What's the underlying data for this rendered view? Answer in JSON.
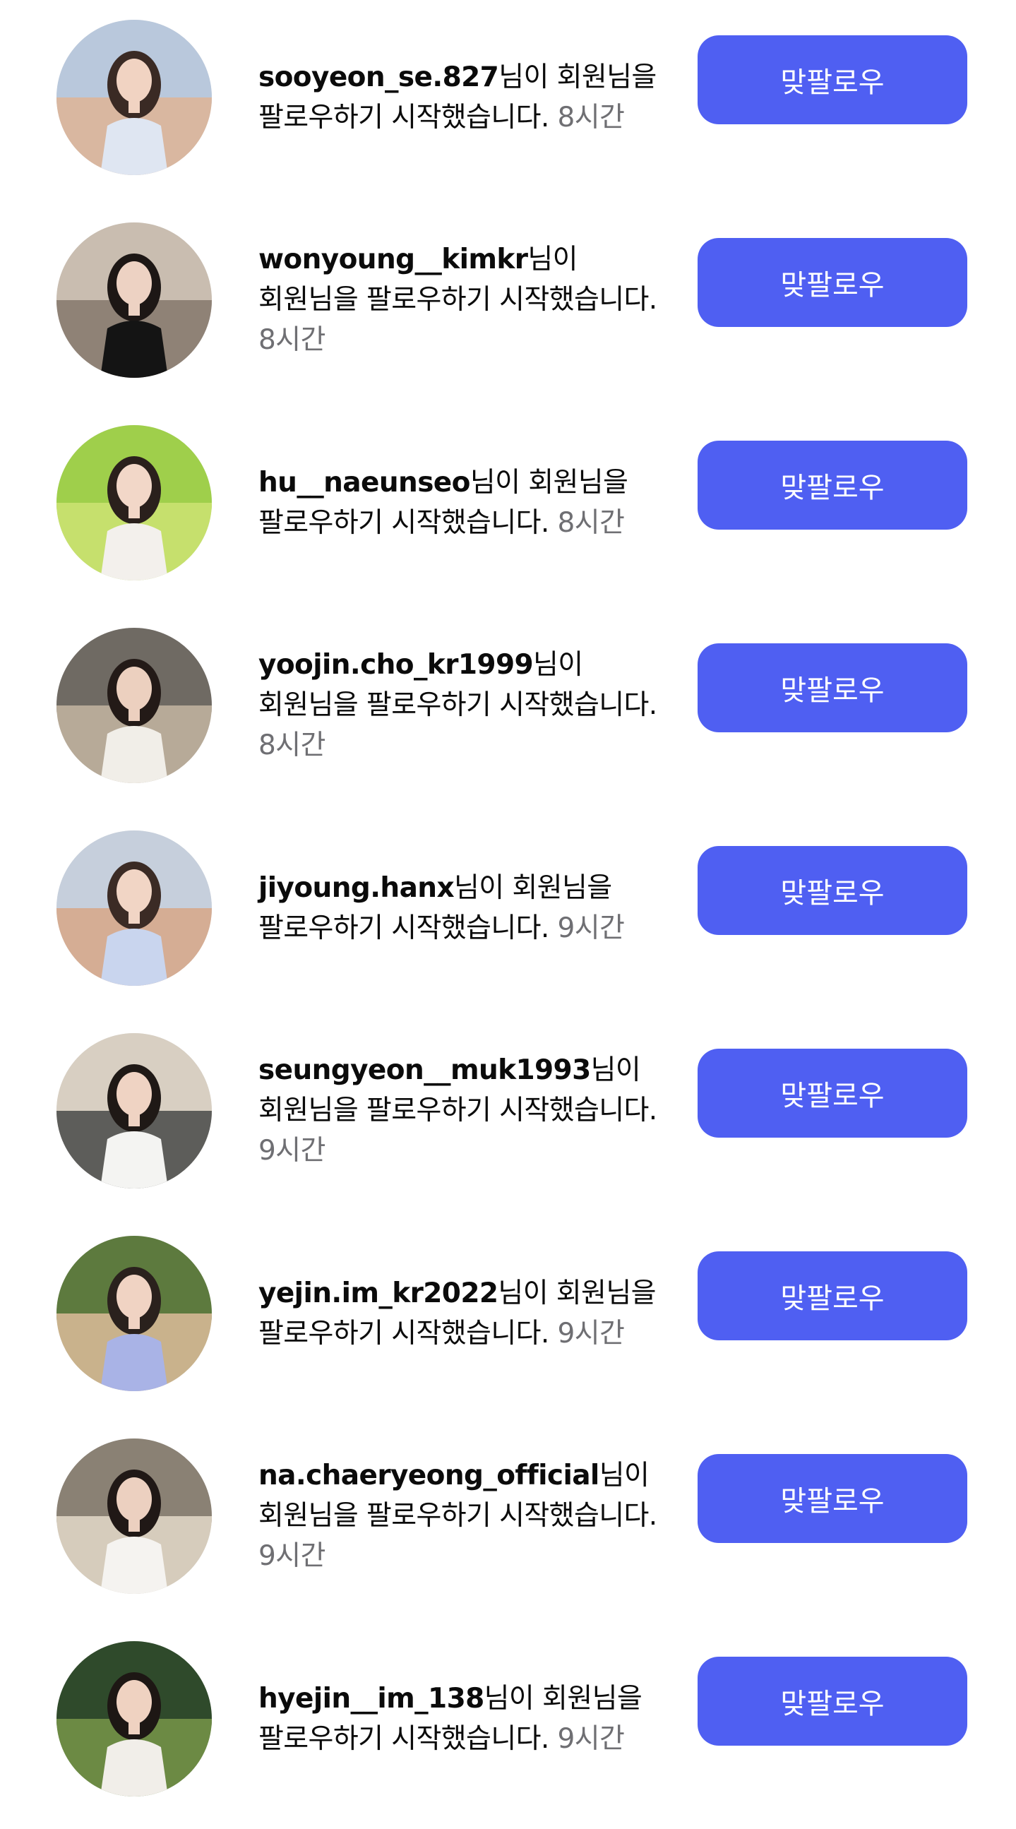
{
  "theme": {
    "button_color": "#4f5ff2",
    "button_text_color": "#ffffff",
    "time_color": "#6f6f73"
  },
  "notifications": [
    {
      "username": "sooyeon_se.827",
      "message": "님이 회원님을 팔로우하기 시작했습니다.",
      "time": "8시간",
      "button_label": "맞팔로우",
      "avatar": {
        "sky": "#b9c8dc",
        "ground": "#d9b7a0",
        "outfit": "#dfe6f2",
        "hair": "#3a2a24",
        "skin": "#f1d3c2"
      }
    },
    {
      "username": "wonyoung__kimkr",
      "message": "님이 회원님을 팔로우하기 시작했습니다.",
      "time": "8시간",
      "button_label": "맞팔로우",
      "avatar": {
        "sky": "#c9bdb0",
        "ground": "#8f8276",
        "outfit": "#141414",
        "hair": "#1d1715",
        "skin": "#edd2c3"
      }
    },
    {
      "username": "hu__naeunseo",
      "message": "님이 회원님을 팔로우하기 시작했습니다.",
      "time": "8시간",
      "button_label": "맞팔로우",
      "avatar": {
        "sky": "#9fcf4b",
        "ground": "#c6e06d",
        "outfit": "#f3f0ec",
        "hair": "#2a201c",
        "skin": "#f2d7c8"
      }
    },
    {
      "username": "yoojin.cho_kr1999",
      "message": "님이 회원님을 팔로우하기 시작했습니다.",
      "time": "8시간",
      "button_label": "맞팔로우",
      "avatar": {
        "sky": "#6f6a63",
        "ground": "#b7aa98",
        "outfit": "#f1eee8",
        "hair": "#231a17",
        "skin": "#ecd0bf"
      }
    },
    {
      "username": "jiyoung.hanx",
      "message": "님이 회원님을 팔로우하기 시작했습니다.",
      "time": "9시간",
      "button_label": "맞팔로우",
      "avatar": {
        "sky": "#c6cfdc",
        "ground": "#d5ad94",
        "outfit": "#c9d5ee",
        "hair": "#3b2b25",
        "skin": "#f1d5c5"
      }
    },
    {
      "username": "seungyeon__muk1993",
      "message": "님이 회원님을 팔로우하기 시작했습니다.",
      "time": "9시간",
      "button_label": "맞팔로우",
      "avatar": {
        "sky": "#d8cfc2",
        "ground": "#5d5d5a",
        "outfit": "#f4f4f2",
        "hair": "#1f1916",
        "skin": "#efd3c3"
      }
    },
    {
      "username": "yejin.im_kr2022",
      "message": "님이 회원님을 팔로우하기 시작했습니다.",
      "time": "9시간",
      "button_label": "맞팔로우",
      "avatar": {
        "sky": "#5d7a3e",
        "ground": "#c9b28c",
        "outfit": "#a9b3e6",
        "hair": "#2a211d",
        "skin": "#f0d3c3"
      }
    },
    {
      "username": "na.chaeryeong_official",
      "message": "님이 회원님을 팔로우하기 시작했습니다.",
      "time": "9시간",
      "button_label": "맞팔로우",
      "avatar": {
        "sky": "#8a8174",
        "ground": "#d6ccbc",
        "outfit": "#f5f3f0",
        "hair": "#201816",
        "skin": "#ecd0c0"
      }
    },
    {
      "username": "hyejin__im_138",
      "message": "님이 회원님을 팔로우하기 시작했습니다.",
      "time": "9시간",
      "button_label": "맞팔로우",
      "avatar": {
        "sky": "#2f4a2b",
        "ground": "#6c8a44",
        "outfit": "#f1eee9",
        "hair": "#1d1714",
        "skin": "#efd2c1"
      }
    }
  ]
}
